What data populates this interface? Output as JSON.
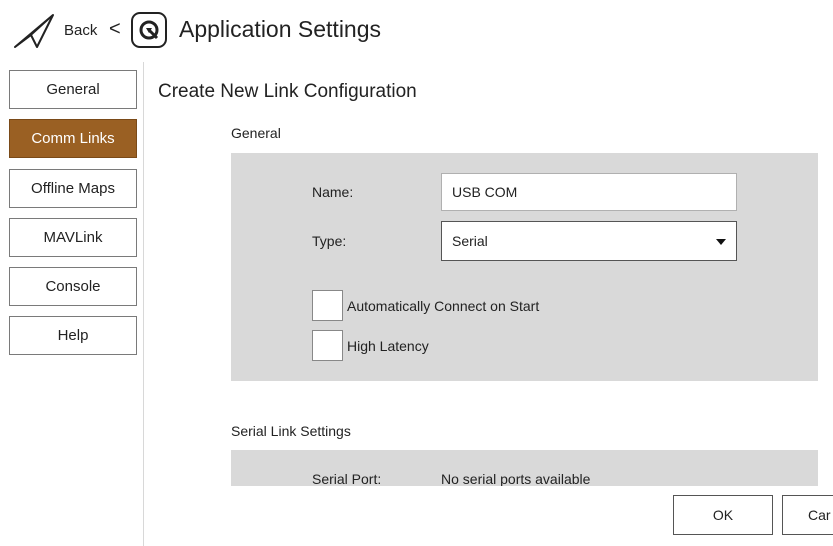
{
  "header": {
    "back_label": "Back",
    "back_arrow": "<",
    "title": "Application Settings",
    "back_icon": "paper-plane-icon",
    "logo_icon": "qgc-logo-icon"
  },
  "sidebar": {
    "items": [
      {
        "label": "General",
        "active": false
      },
      {
        "label": "Comm Links",
        "active": true
      },
      {
        "label": "Offline Maps",
        "active": false
      },
      {
        "label": "MAVLink",
        "active": false
      },
      {
        "label": "Console",
        "active": false
      },
      {
        "label": "Help",
        "active": false
      }
    ],
    "active_color": "#9a6023"
  },
  "main": {
    "title": "Create New Link Configuration",
    "general": {
      "section_label": "General",
      "name_label": "Name:",
      "name_value": "USB COM",
      "type_label": "Type:",
      "type_value": "Serial",
      "auto_connect_label": "Automatically Connect on Start",
      "high_latency_label": "High Latency"
    },
    "serial": {
      "section_label": "Serial Link Settings",
      "port_label": "Serial Port:",
      "port_value": "No serial ports available"
    }
  },
  "footer": {
    "ok_label": "OK",
    "cancel_label": "Car"
  }
}
